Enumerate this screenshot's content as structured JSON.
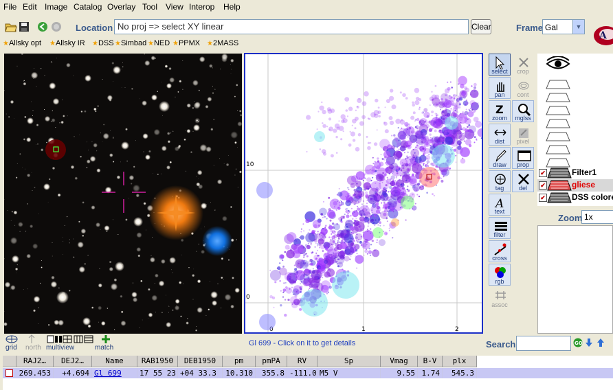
{
  "menu": [
    "File",
    "Edit",
    "Image",
    "Catalog",
    "Overlay",
    "Tool",
    "View",
    "Interop",
    "Help"
  ],
  "toolbar": {
    "location_label": "Location",
    "location_value": "No proj => select XY linear",
    "clear_label": "Clear",
    "frame_label": "Frame",
    "frame_value": "Gal"
  },
  "bookmarks": [
    "Allsky opt",
    "Allsky IR",
    "DSS",
    "Simbad",
    "NED",
    "PPMX",
    "2MASS"
  ],
  "plot": {
    "y_ticks": [
      "10",
      "0"
    ],
    "x_ticks": [
      "0",
      "1",
      "2"
    ]
  },
  "tools": [
    {
      "name": "select",
      "label": "select",
      "state": "selected"
    },
    {
      "name": "crop",
      "label": "crop",
      "state": "disabled"
    },
    {
      "name": "pan",
      "label": "pan",
      "state": "normal"
    },
    {
      "name": "cont",
      "label": "cont",
      "state": "disabled"
    },
    {
      "name": "zoom",
      "label": "zoom",
      "state": "normal"
    },
    {
      "name": "mglss",
      "label": "mglss",
      "state": "normal"
    },
    {
      "name": "dist",
      "label": "dist",
      "state": "normal"
    },
    {
      "name": "pixel",
      "label": "pixel",
      "state": "disabled"
    },
    {
      "name": "draw",
      "label": "draw",
      "state": "normal"
    },
    {
      "name": "prop",
      "label": "prop",
      "state": "normal"
    },
    {
      "name": "tag",
      "label": "tag",
      "state": "normal"
    },
    {
      "name": "del",
      "label": "del",
      "state": "normal"
    },
    {
      "name": "text",
      "label": "text",
      "state": "normal"
    },
    {
      "name": "filter",
      "label": "filter",
      "state": "normal"
    },
    {
      "name": "cross",
      "label": "cross",
      "state": "normal"
    },
    {
      "name": "rgb",
      "label": "rgb",
      "state": "normal"
    },
    {
      "name": "assoc",
      "label": "assoc",
      "state": "disabled"
    }
  ],
  "layers": [
    {
      "name": "Filter1",
      "checked": true,
      "color": "#000000",
      "selected": false
    },
    {
      "name": "gliese",
      "checked": true,
      "color": "#e00000",
      "selected": true
    },
    {
      "name": "DSS colored",
      "checked": true,
      "color": "#000000",
      "selected": false
    }
  ],
  "zoom": {
    "label": "Zoom",
    "value": "1x"
  },
  "bottom_tools": [
    "grid",
    "north",
    "multiview",
    "match"
  ],
  "status": "Gl 699 - Click on it to get details",
  "search": {
    "label": "Search",
    "value": ""
  },
  "table": {
    "headers": [
      "RAJ2…",
      "DEJ2…",
      "Name",
      "RAB1950",
      "DEB1950",
      "pm",
      "pmPA",
      "RV",
      "Sp",
      "Vmag",
      "B-V",
      "plx"
    ],
    "rows": [
      [
        "269.453",
        "+4.694",
        "Gl 699",
        "17 55 23",
        "+04 33.3",
        "10.310",
        "355.8",
        "-111.0",
        "M5 V",
        "9.55",
        "1.74",
        "545.3"
      ]
    ]
  }
}
